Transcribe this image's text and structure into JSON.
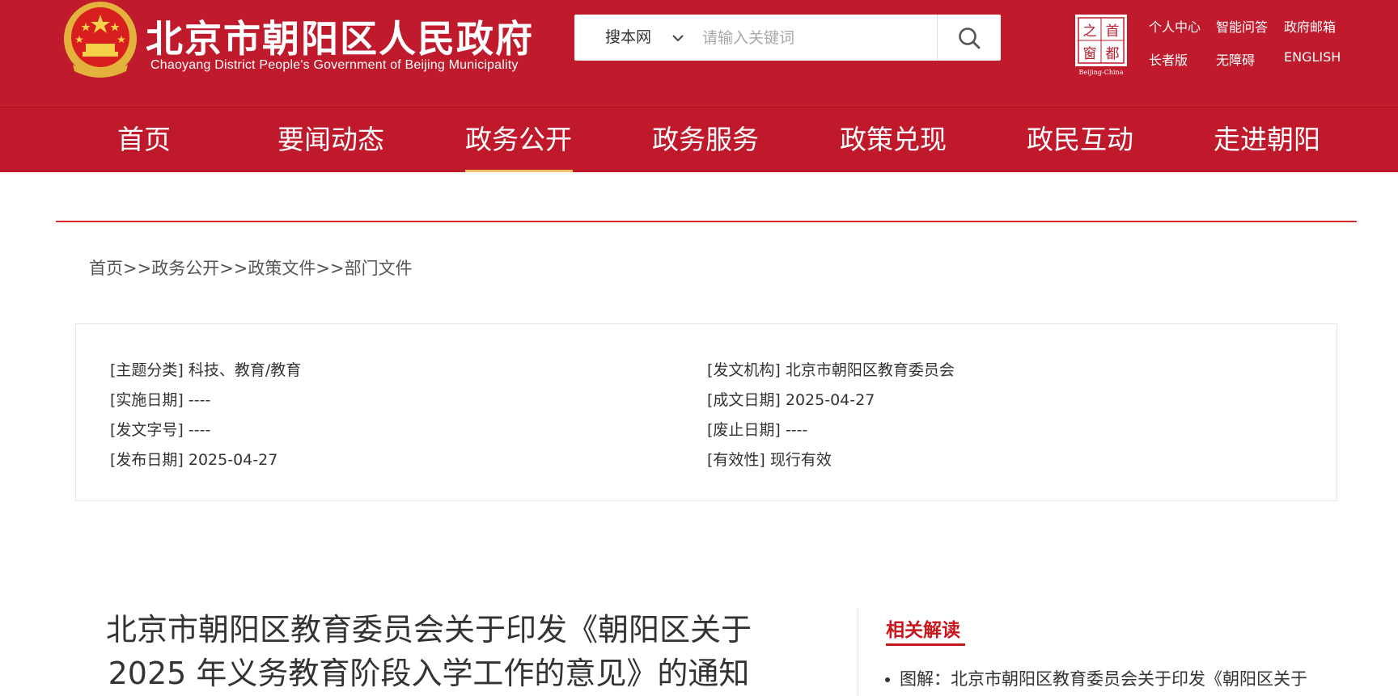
{
  "header": {
    "site_title": "北京市朝阳区人民政府",
    "site_subtitle": "Chaoyang District People's Government of Beijing Municipality",
    "search": {
      "scope": "搜本网",
      "placeholder": "请输入关键词"
    },
    "capital_logo": {
      "chars": [
        "之",
        "首",
        "窗",
        "都"
      ],
      "caption": "Beijing-China"
    },
    "top_links": [
      "个人中心",
      "智能问答",
      "政府邮箱",
      "长者版",
      "无障碍",
      "ENGLISH"
    ]
  },
  "nav": {
    "items": [
      "首页",
      "要闻动态",
      "政务公开",
      "政务服务",
      "政策兑现",
      "政民互动",
      "走进朝阳"
    ],
    "active": "政务公开"
  },
  "breadcrumb": [
    "首页",
    "政务公开",
    "政策文件",
    "部门文件"
  ],
  "breadcrumb_sep": ">>",
  "meta": {
    "left": [
      {
        "label": "[主题分类]",
        "value": "科技、教育/教育"
      },
      {
        "label": "[实施日期]",
        "value": "----"
      },
      {
        "label": "[发文字号]",
        "value": "----"
      },
      {
        "label": "[发布日期]",
        "value": "2025-04-27"
      }
    ],
    "right": [
      {
        "label": "[发文机构]",
        "value": "北京市朝阳区教育委员会"
      },
      {
        "label": "[成文日期]",
        "value": "2025-04-27"
      },
      {
        "label": "[废止日期]",
        "value": "----"
      },
      {
        "label": "[有效性]",
        "value": "现行有效"
      }
    ]
  },
  "article": {
    "title_line1": "北京市朝阳区教育委员会关于印发《朝阳区关于",
    "title_line2": "2025 年义务教育阶段入学工作的意见》的通知"
  },
  "related": {
    "heading": "相关解读",
    "items": [
      "图解：北京市朝阳区教育委员会关于印发《朝阳区关于"
    ]
  },
  "colors": {
    "header_red": "#bf1b2c",
    "accent_red": "#c8161d",
    "nav_active_underline": "#f0c36a"
  }
}
